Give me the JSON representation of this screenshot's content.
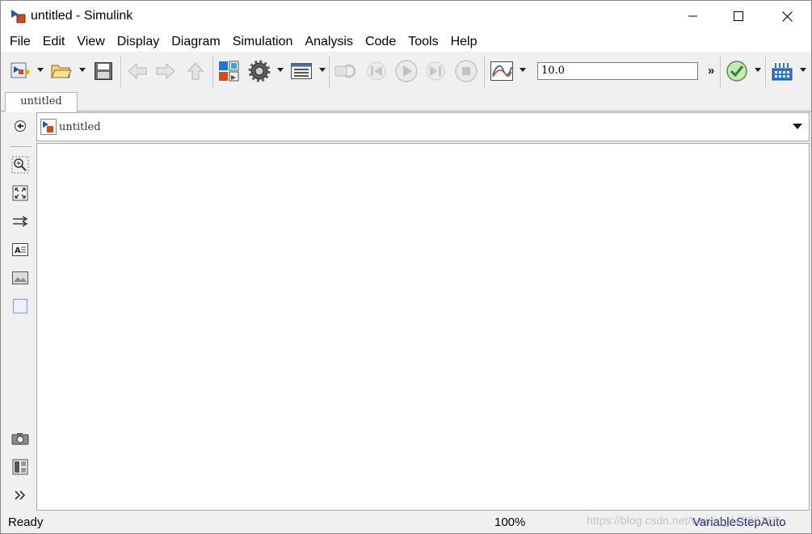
{
  "window": {
    "title": "untitled - Simulink",
    "controls": {
      "minimize": "minimize-icon",
      "maximize": "maximize-icon",
      "close": "close-icon"
    }
  },
  "menubar": {
    "items": [
      {
        "label": "File"
      },
      {
        "label": "Edit"
      },
      {
        "label": "View"
      },
      {
        "label": "Display"
      },
      {
        "label": "Diagram"
      },
      {
        "label": "Simulation"
      },
      {
        "label": "Analysis"
      },
      {
        "label": "Code"
      },
      {
        "label": "Tools"
      },
      {
        "label": "Help"
      }
    ]
  },
  "toolbar": {
    "stop_time": "10.0",
    "overflow": "»"
  },
  "tabs": [
    {
      "label": "untitled",
      "active": true
    }
  ],
  "explorer": {
    "breadcrumb": "untitled"
  },
  "statusbar": {
    "status": "Ready",
    "zoom": "100%",
    "solver": "VariableStepAuto"
  },
  "watermark": "https://blog.csdn.net/weixin_44808168",
  "colors": {
    "chrome_bg": "#f0f0f0",
    "canvas_bg": "#ffffff",
    "solver_text": "#1a237e",
    "check_green": "#3aa33a",
    "model_block_orange": "#c84c1e"
  }
}
